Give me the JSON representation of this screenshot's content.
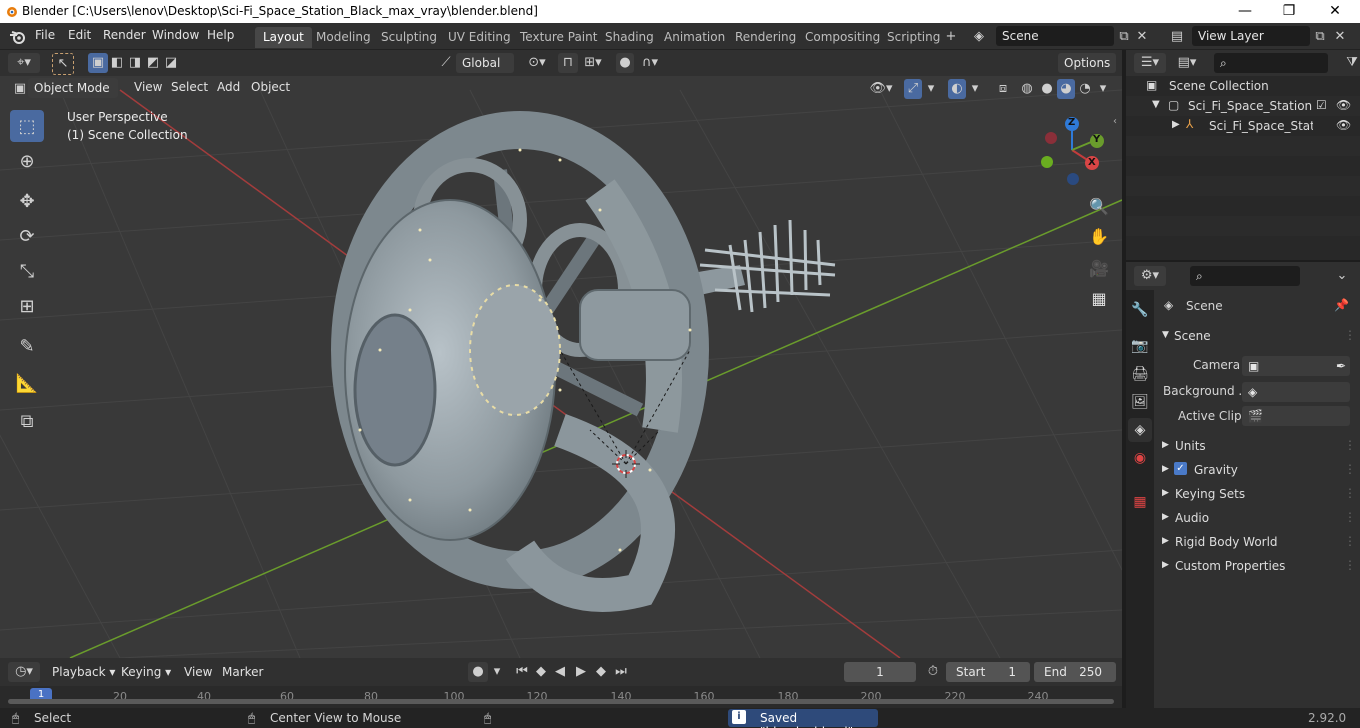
{
  "window": {
    "title": "Blender [C:\\Users\\lenov\\Desktop\\Sci-Fi_Space_Station_Black_max_vray\\blender.blend]",
    "minimize": "—",
    "maximize": "❐",
    "close": "✕"
  },
  "menus": [
    "File",
    "Edit",
    "Render",
    "Window",
    "Help"
  ],
  "workspaces": [
    "Layout",
    "Modeling",
    "Sculpting",
    "UV Editing",
    "Texture Paint",
    "Shading",
    "Animation",
    "Rendering",
    "Compositing",
    "Scripting"
  ],
  "active_workspace": "Layout",
  "scene_field": "Scene",
  "view_layer_field": "View Layer",
  "viewport": {
    "transform_orientation": "Global",
    "options_label": "Options",
    "mode": "Object Mode",
    "header_menus": [
      "View",
      "Select",
      "Add",
      "Object"
    ],
    "overlay_text_1": "User Perspective",
    "overlay_text_2": "(1) Scene Collection",
    "gizmo": {
      "z": "Z",
      "y": "Y",
      "x": "X"
    }
  },
  "outliner": {
    "root": "Scene Collection",
    "collection": "Sci_Fi_Space_Station_Bla",
    "object": "Sci_Fi_Space_Statior"
  },
  "properties": {
    "context": "Scene",
    "panel_title": "Scene",
    "camera_label": "Camera",
    "background_label": "Background ...",
    "active_clip_label": "Active Clip",
    "sections": [
      "Units",
      "Gravity",
      "Keying Sets",
      "Audio",
      "Rigid Body World",
      "Custom Properties"
    ],
    "gravity_checked": true
  },
  "timeline": {
    "menus": [
      "Playback",
      "Keying",
      "View",
      "Marker"
    ],
    "current_frame": "1",
    "start_label": "Start",
    "start_value": "1",
    "end_label": "End",
    "end_value": "250",
    "ticks": [
      "1",
      "20",
      "40",
      "60",
      "80",
      "100",
      "120",
      "140",
      "160",
      "180",
      "200",
      "220",
      "240"
    ]
  },
  "statusbar": {
    "left": "Select",
    "middle": "Center View to Mouse",
    "message": "Saved \"blender.blend\"",
    "version": "2.92.0"
  },
  "colors": {
    "accent": "#4a6aa0",
    "viewport_bg": "#393939",
    "x_axis": "#c33c3c",
    "y_axis": "#6a9c2c",
    "z_axis": "#2f7ad8"
  }
}
